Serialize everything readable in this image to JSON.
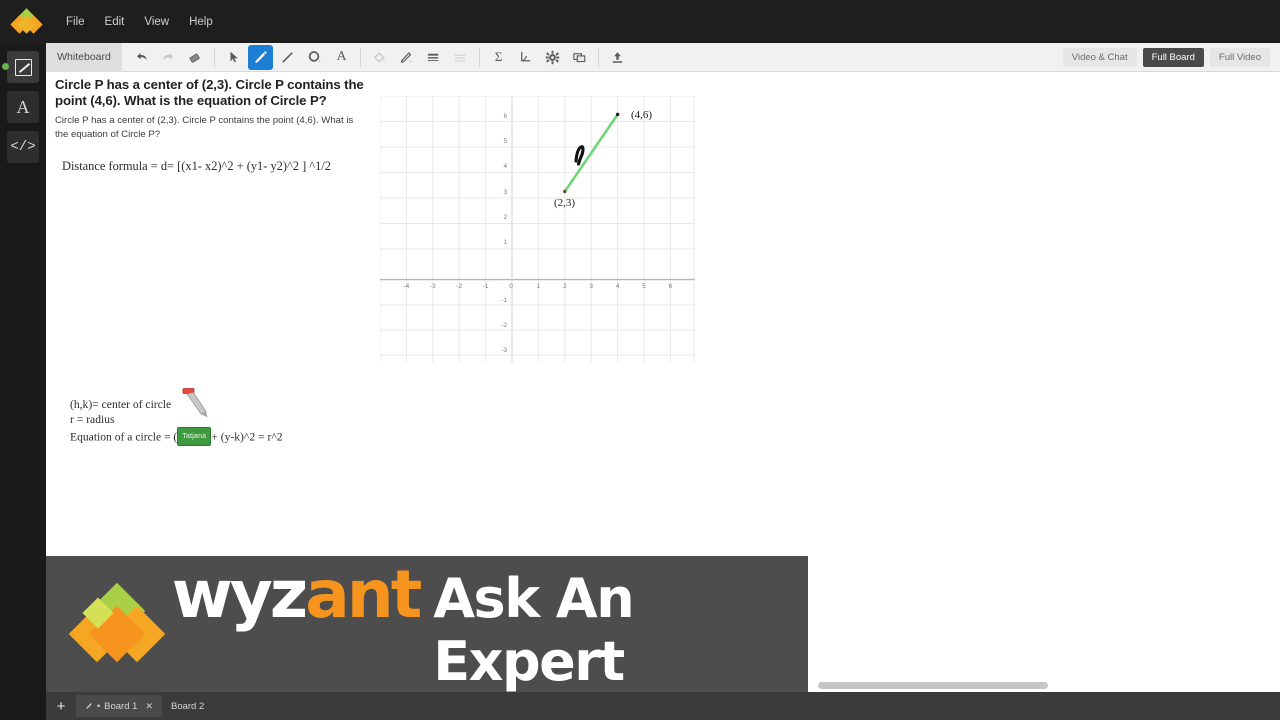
{
  "app": {
    "logo": "wyzant-diamond-logo",
    "menu": [
      "File",
      "Edit",
      "View",
      "Help"
    ]
  },
  "rail": {
    "items": [
      {
        "name": "whiteboard-tool",
        "icon": "whiteboard-pen-icon",
        "active": true
      },
      {
        "name": "text-tool",
        "icon": "text-A-icon",
        "label": "A",
        "active": false
      },
      {
        "name": "code-tool",
        "icon": "code-brackets-icon",
        "label": "</>",
        "active": false
      }
    ]
  },
  "toolbar": {
    "tab_label": "Whiteboard",
    "tools": [
      {
        "name": "undo",
        "icon": "undo-arrow-icon",
        "state": "enabled"
      },
      {
        "name": "redo",
        "icon": "redo-arrow-icon",
        "state": "disabled"
      },
      {
        "name": "eraser",
        "icon": "eraser-icon",
        "state": "enabled"
      },
      {
        "name": "select",
        "icon": "cursor-arrow-icon",
        "state": "enabled"
      },
      {
        "name": "pen",
        "icon": "pencil-icon",
        "state": "selected"
      },
      {
        "name": "line",
        "icon": "line-icon",
        "state": "enabled"
      },
      {
        "name": "shape",
        "icon": "circle-shape-icon",
        "state": "enabled"
      },
      {
        "name": "text",
        "icon": "text-A-icon",
        "state": "enabled"
      },
      {
        "name": "fill",
        "icon": "paint-bucket-icon",
        "state": "disabled"
      },
      {
        "name": "stroke-color",
        "icon": "pen-color-icon",
        "state": "enabled"
      },
      {
        "name": "stroke-width",
        "icon": "line-weight-icon",
        "state": "enabled"
      },
      {
        "name": "line-style",
        "icon": "dashed-line-icon",
        "state": "disabled"
      },
      {
        "name": "math",
        "icon": "sigma-icon",
        "state": "enabled"
      },
      {
        "name": "graph",
        "icon": "graph-axes-icon",
        "state": "enabled"
      },
      {
        "name": "settings",
        "icon": "gear-icon",
        "state": "enabled"
      },
      {
        "name": "duplicate",
        "icon": "copy-layers-icon",
        "state": "enabled"
      },
      {
        "name": "upload",
        "icon": "upload-icon",
        "state": "enabled"
      }
    ],
    "view_buttons": [
      {
        "label": "Video & Chat",
        "active": false
      },
      {
        "label": "Full Board",
        "active": true
      },
      {
        "label": "Full Video",
        "active": false
      }
    ]
  },
  "board": {
    "question_title": "Circle P has a center of (2,3). Circle P contains the point (4,6). What is the equation of Circle P?",
    "question_body": "Circle P has a center of (2,3). Circle P contains the point (4,6). What is the equation of Circle P?",
    "distance_formula": "Distance formula = d= [(x1- x2)^2  + (y1- y2)^2 ] ^1/2",
    "notes": [
      "(h,k)= center of circle",
      "r = radius"
    ],
    "equation_prefix": "Equation of a circle  = (",
    "equation_suffix": "+ (y-k)^2 = r^2",
    "collaborator_badge": "Tatjana",
    "cursor_icon": "stylus-cursor-icon"
  },
  "chart_data": {
    "type": "scatter",
    "title": "",
    "xlabel": "",
    "ylabel": "",
    "xlim": [
      -4.6,
      6.6
    ],
    "ylim": [
      -3.6,
      6.6
    ],
    "xticks": [
      -4,
      -3,
      -2,
      -1,
      0,
      1,
      2,
      3,
      4,
      5,
      6
    ],
    "yticks": [
      -3,
      -2,
      -1,
      0,
      1,
      2,
      3,
      4,
      5,
      6
    ],
    "grid": true,
    "legend": "none",
    "points": [
      {
        "label": "(2,3)",
        "x": 2,
        "y": 3
      },
      {
        "label": "(4,6)",
        "x": 4,
        "y": 6
      }
    ],
    "series": [
      {
        "name": "radius-segment",
        "type": "line",
        "color": "#6ed678",
        "x": [
          2,
          4
        ],
        "y": [
          3,
          6
        ]
      }
    ],
    "annotations": [
      {
        "text": "r",
        "x": 2.75,
        "y": 4.55,
        "style": "handwritten"
      },
      {
        "text": "(2,3)",
        "x": 2.0,
        "y": 2.55
      },
      {
        "text": "(4,6)",
        "x": 4.5,
        "y": 6.1
      }
    ]
  },
  "banner": {
    "logo_name": "wyzant-diamond-logo",
    "word_wy": "wyz",
    "word_ant": "ant",
    "tagline": "Ask An Expert"
  },
  "tabs": {
    "add_label": "+",
    "items": [
      {
        "label": "Board 1",
        "active": true,
        "closable": true,
        "pen_icon": "pencil-icon",
        "dot": "•"
      },
      {
        "label": "Board 2",
        "active": false,
        "closable": false
      }
    ]
  },
  "colors": {
    "accent_blue": "#1d7fd4",
    "line_green": "#6ed678",
    "badge_green": "#3f9a3f",
    "brand_orange": "#f7941e",
    "brand_green": "#a8cf45"
  }
}
